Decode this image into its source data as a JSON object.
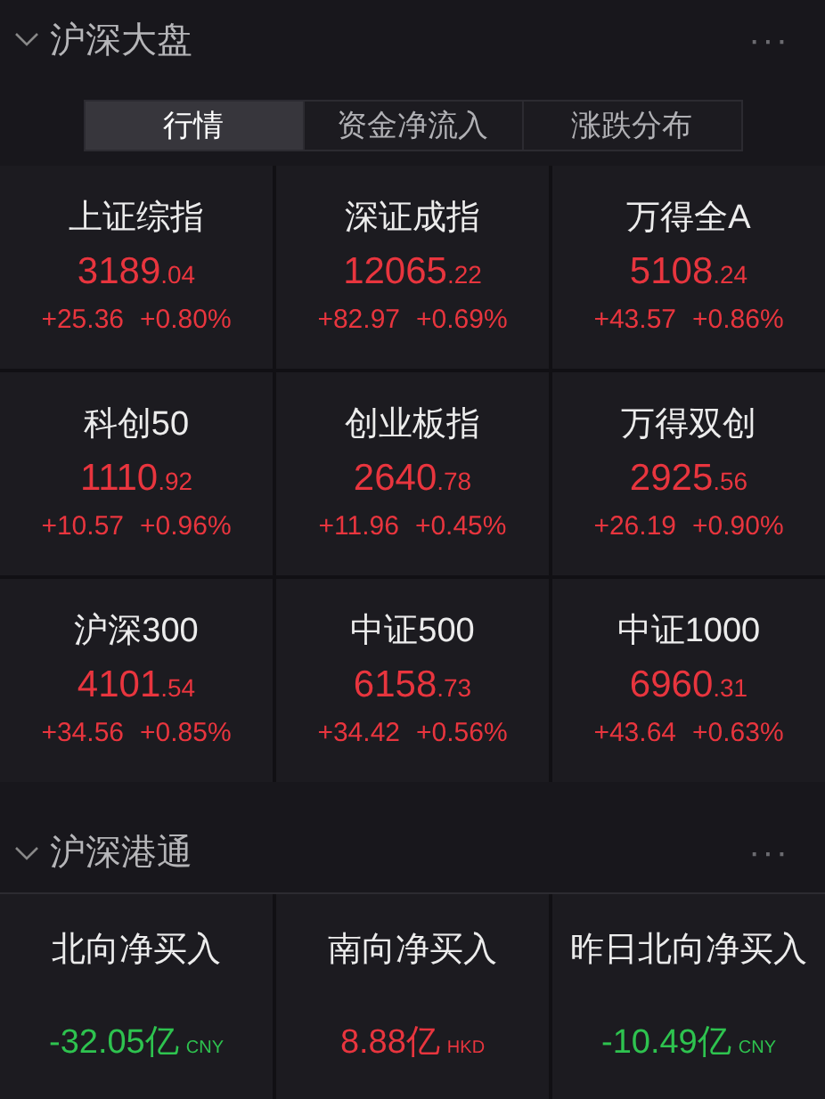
{
  "market": {
    "title": "沪深大盘",
    "expanded": true,
    "more": "···",
    "tabs": [
      {
        "label": "行情",
        "selected": true
      },
      {
        "label": "资金净流入",
        "selected": false
      },
      {
        "label": "涨跌分布",
        "selected": false
      }
    ],
    "indices": [
      {
        "name": "上证综指",
        "price_int": "3189",
        "price_dec": ".04",
        "change": "+25.36",
        "pct": "+0.80%",
        "color": "#e8353e"
      },
      {
        "name": "深证成指",
        "price_int": "12065",
        "price_dec": ".22",
        "change": "+82.97",
        "pct": "+0.69%",
        "color": "#e8353e"
      },
      {
        "name": "万得全A",
        "price_int": "5108",
        "price_dec": ".24",
        "change": "+43.57",
        "pct": "+0.86%",
        "color": "#e8353e"
      },
      {
        "name": "科创50",
        "price_int": "1110",
        "price_dec": ".92",
        "change": "+10.57",
        "pct": "+0.96%",
        "color": "#e8353e"
      },
      {
        "name": "创业板指",
        "price_int": "2640",
        "price_dec": ".78",
        "change": "+11.96",
        "pct": "+0.45%",
        "color": "#e8353e"
      },
      {
        "name": "万得双创",
        "price_int": "2925",
        "price_dec": ".56",
        "change": "+26.19",
        "pct": "+0.90%",
        "color": "#e8353e"
      },
      {
        "name": "沪深300",
        "price_int": "4101",
        "price_dec": ".54",
        "change": "+34.56",
        "pct": "+0.85%",
        "color": "#e8353e"
      },
      {
        "name": "中证500",
        "price_int": "6158",
        "price_dec": ".73",
        "change": "+34.42",
        "pct": "+0.56%",
        "color": "#e8353e"
      },
      {
        "name": "中证1000",
        "price_int": "6960",
        "price_dec": ".31",
        "change": "+43.64",
        "pct": "+0.63%",
        "color": "#e8353e"
      }
    ]
  },
  "connect": {
    "title": "沪深港通",
    "expanded": true,
    "more": "···",
    "flows": [
      {
        "label": "北向净买入",
        "value": "-32.05亿",
        "unit": "CNY",
        "color": "#2ec34f"
      },
      {
        "label": "南向净买入",
        "value": "8.88亿",
        "unit": "HKD",
        "color": "#e8353e"
      },
      {
        "label": "昨日北向净买入",
        "value": "-10.49亿",
        "unit": "CNY",
        "color": "#2ec34f"
      }
    ]
  }
}
